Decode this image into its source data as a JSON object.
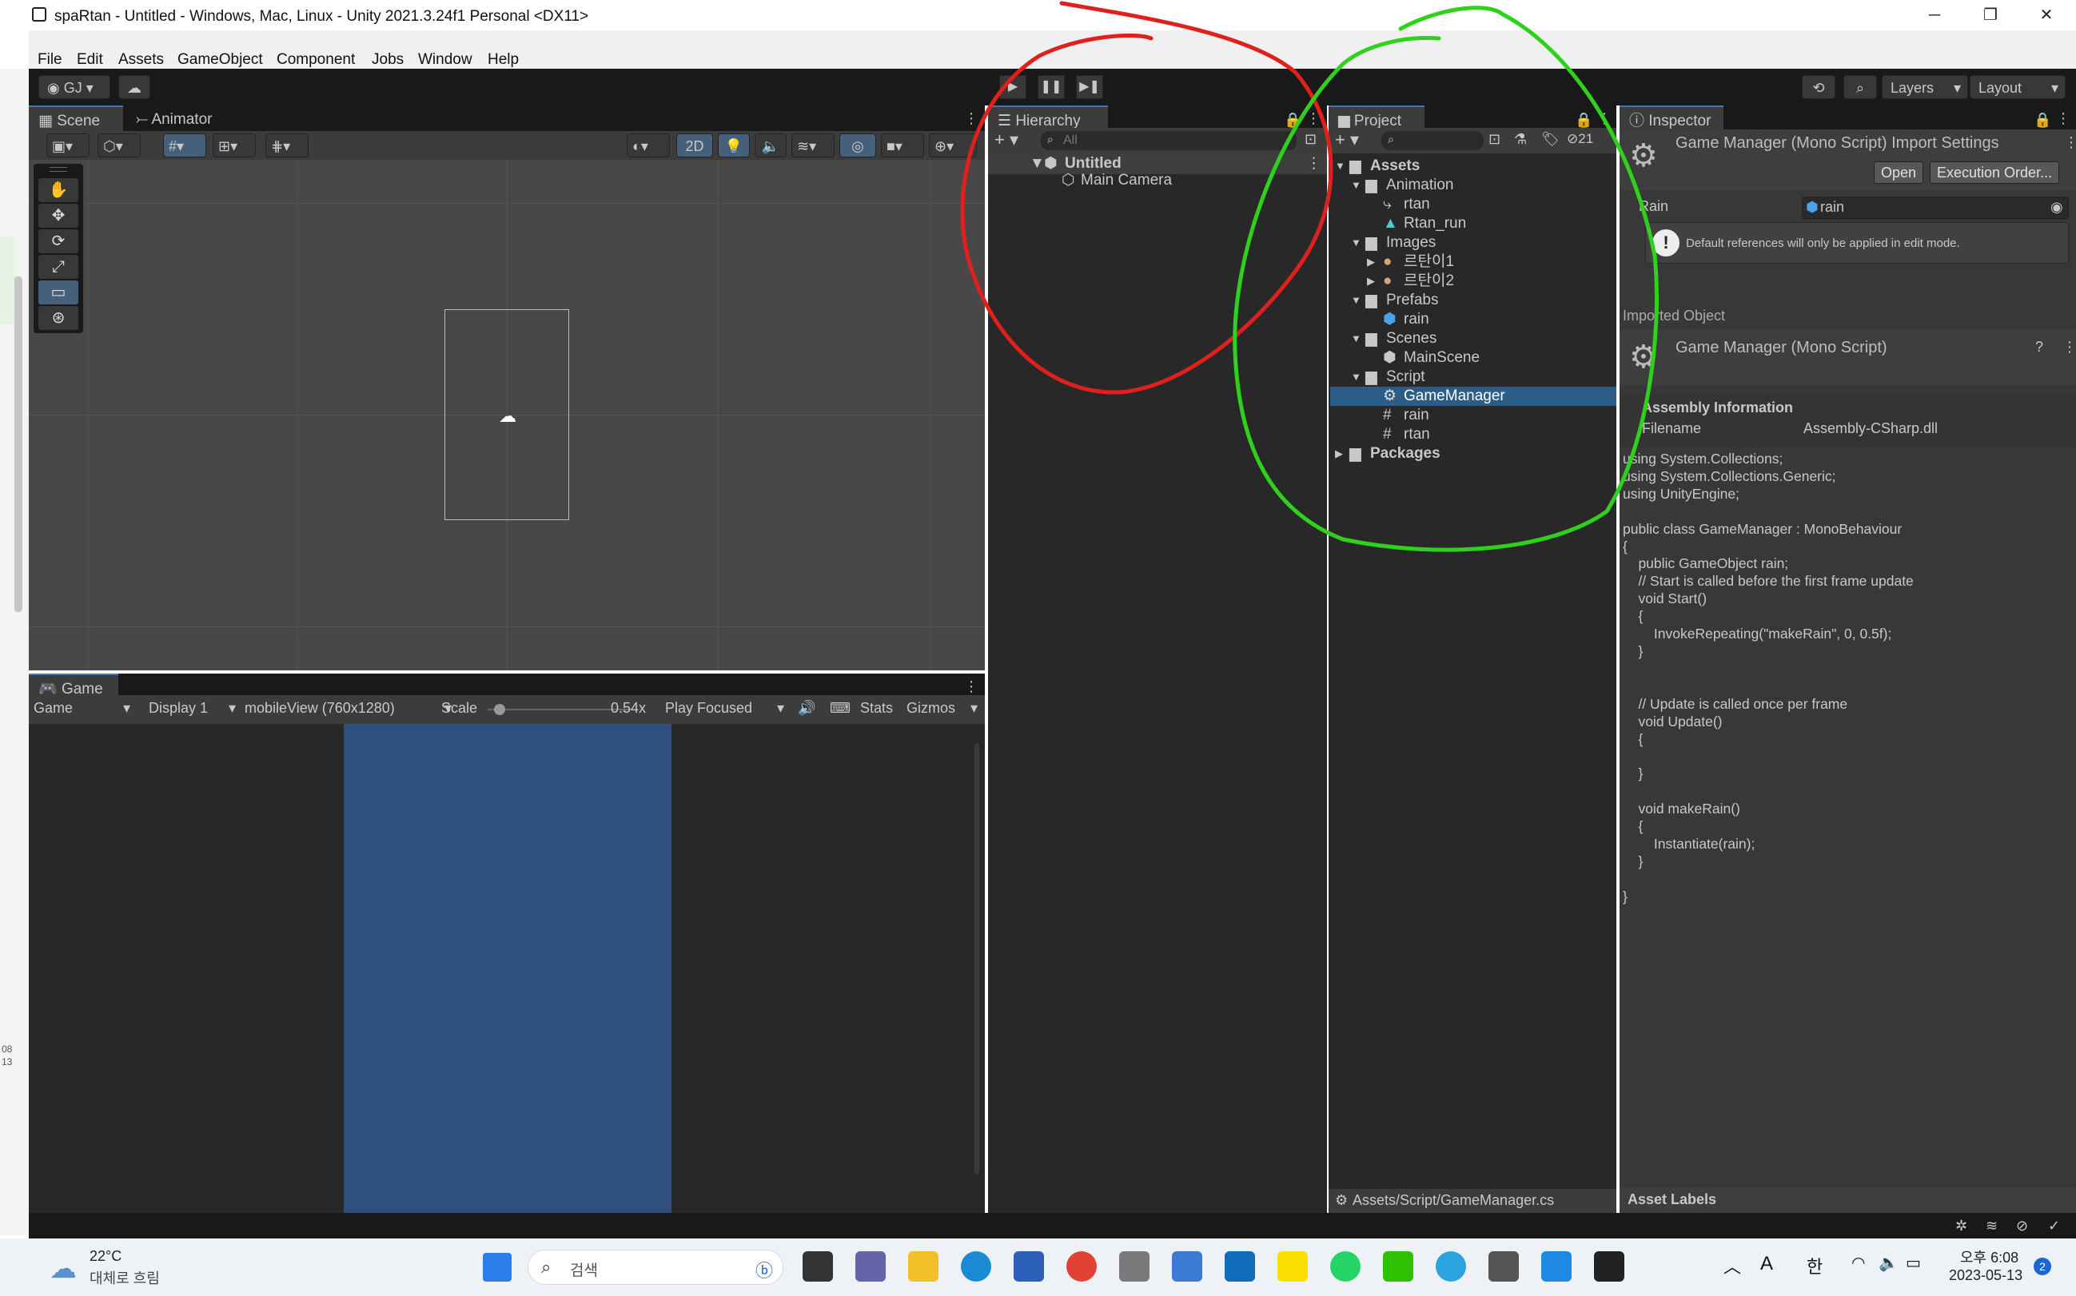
{
  "window": {
    "title": "spaRtan - Untitled - Windows, Mac, Linux - Unity 2021.3.24f1 Personal <DX11>",
    "minimize": "─",
    "maximize": "❐",
    "close": "✕"
  },
  "menu": [
    "File",
    "Edit",
    "Assets",
    "GameObject",
    "Component",
    "Jobs",
    "Window",
    "Help"
  ],
  "toolbar": {
    "account": "GJ",
    "layers": "Layers",
    "layout": "Layout"
  },
  "scene": {
    "tabs": [
      "Scene",
      "Animator"
    ],
    "mode_2d": "2D"
  },
  "game": {
    "tab": "Game",
    "view_select": "Game",
    "display": "Display 1",
    "resolution": "mobileView (760x1280)",
    "scale_label": "Scale",
    "scale_value": "0.54x",
    "play_focused": "Play Focused",
    "stats": "Stats",
    "gizmos": "Gizmos"
  },
  "hierarchy": {
    "tab": "Hierarchy",
    "search_placeholder": "All",
    "scene": "Untitled",
    "items": [
      "Main Camera"
    ]
  },
  "project": {
    "tab": "Project",
    "visible_count": "21",
    "tree": {
      "assets": "Assets",
      "animation": "Animation",
      "anim_items": [
        "rtan",
        "Rtan_run"
      ],
      "images": "Images",
      "image_items": [
        "르탄이1",
        "르탄이2"
      ],
      "prefabs": "Prefabs",
      "prefab_items": [
        "rain"
      ],
      "scenes": "Scenes",
      "scene_items": [
        "MainScene"
      ],
      "script": "Script",
      "script_items": [
        "GameManager",
        "rain",
        "rtan"
      ],
      "packages": "Packages"
    },
    "footer_path": "Assets/Script/GameManager.cs"
  },
  "inspector": {
    "tab": "Inspector",
    "header_title": "Game Manager (Mono Script) Import Settings",
    "open_button": "Open",
    "exec_order_button": "Execution Order...",
    "rain_label": "Rain",
    "rain_value": "rain",
    "notice": "Default references will only be applied in edit mode.",
    "imported_object": "Imported Object",
    "imported_title": "Game Manager (Mono Script)",
    "assembly_header": "Assembly Information",
    "filename_label": "Filename",
    "filename_value": "Assembly-CSharp.dll",
    "code": "using System.Collections;\nusing System.Collections.Generic;\nusing UnityEngine;\n\npublic class GameManager : MonoBehaviour\n{\n    public GameObject rain;\n    // Start is called before the first frame update\n    void Start()\n    {\n        InvokeRepeating(\"makeRain\", 0, 0.5f);\n    }\n\n\n    // Update is called once per frame\n    void Update()\n    {\n\n    }\n\n    void makeRain()\n    {\n        Instantiate(rain);\n    }\n\n}",
    "asset_labels": "Asset Labels"
  },
  "taskbar": {
    "weather_temp": "22°C",
    "weather_desc": "대체로 흐림",
    "search_placeholder": "검색",
    "time": "오후 6:08",
    "date": "2023-05-13",
    "ime_a": "A",
    "ime_han": "한",
    "notification_count": "2"
  },
  "left_strip": {
    "clock_top": "08",
    "clock_bottom": "13"
  },
  "colors": {
    "accent": "#3a79bb",
    "selection": "#2c5d87",
    "game_blue": "#2f4f7f",
    "annotation_red": "#e0201c",
    "annotation_green": "#2fd11c"
  }
}
